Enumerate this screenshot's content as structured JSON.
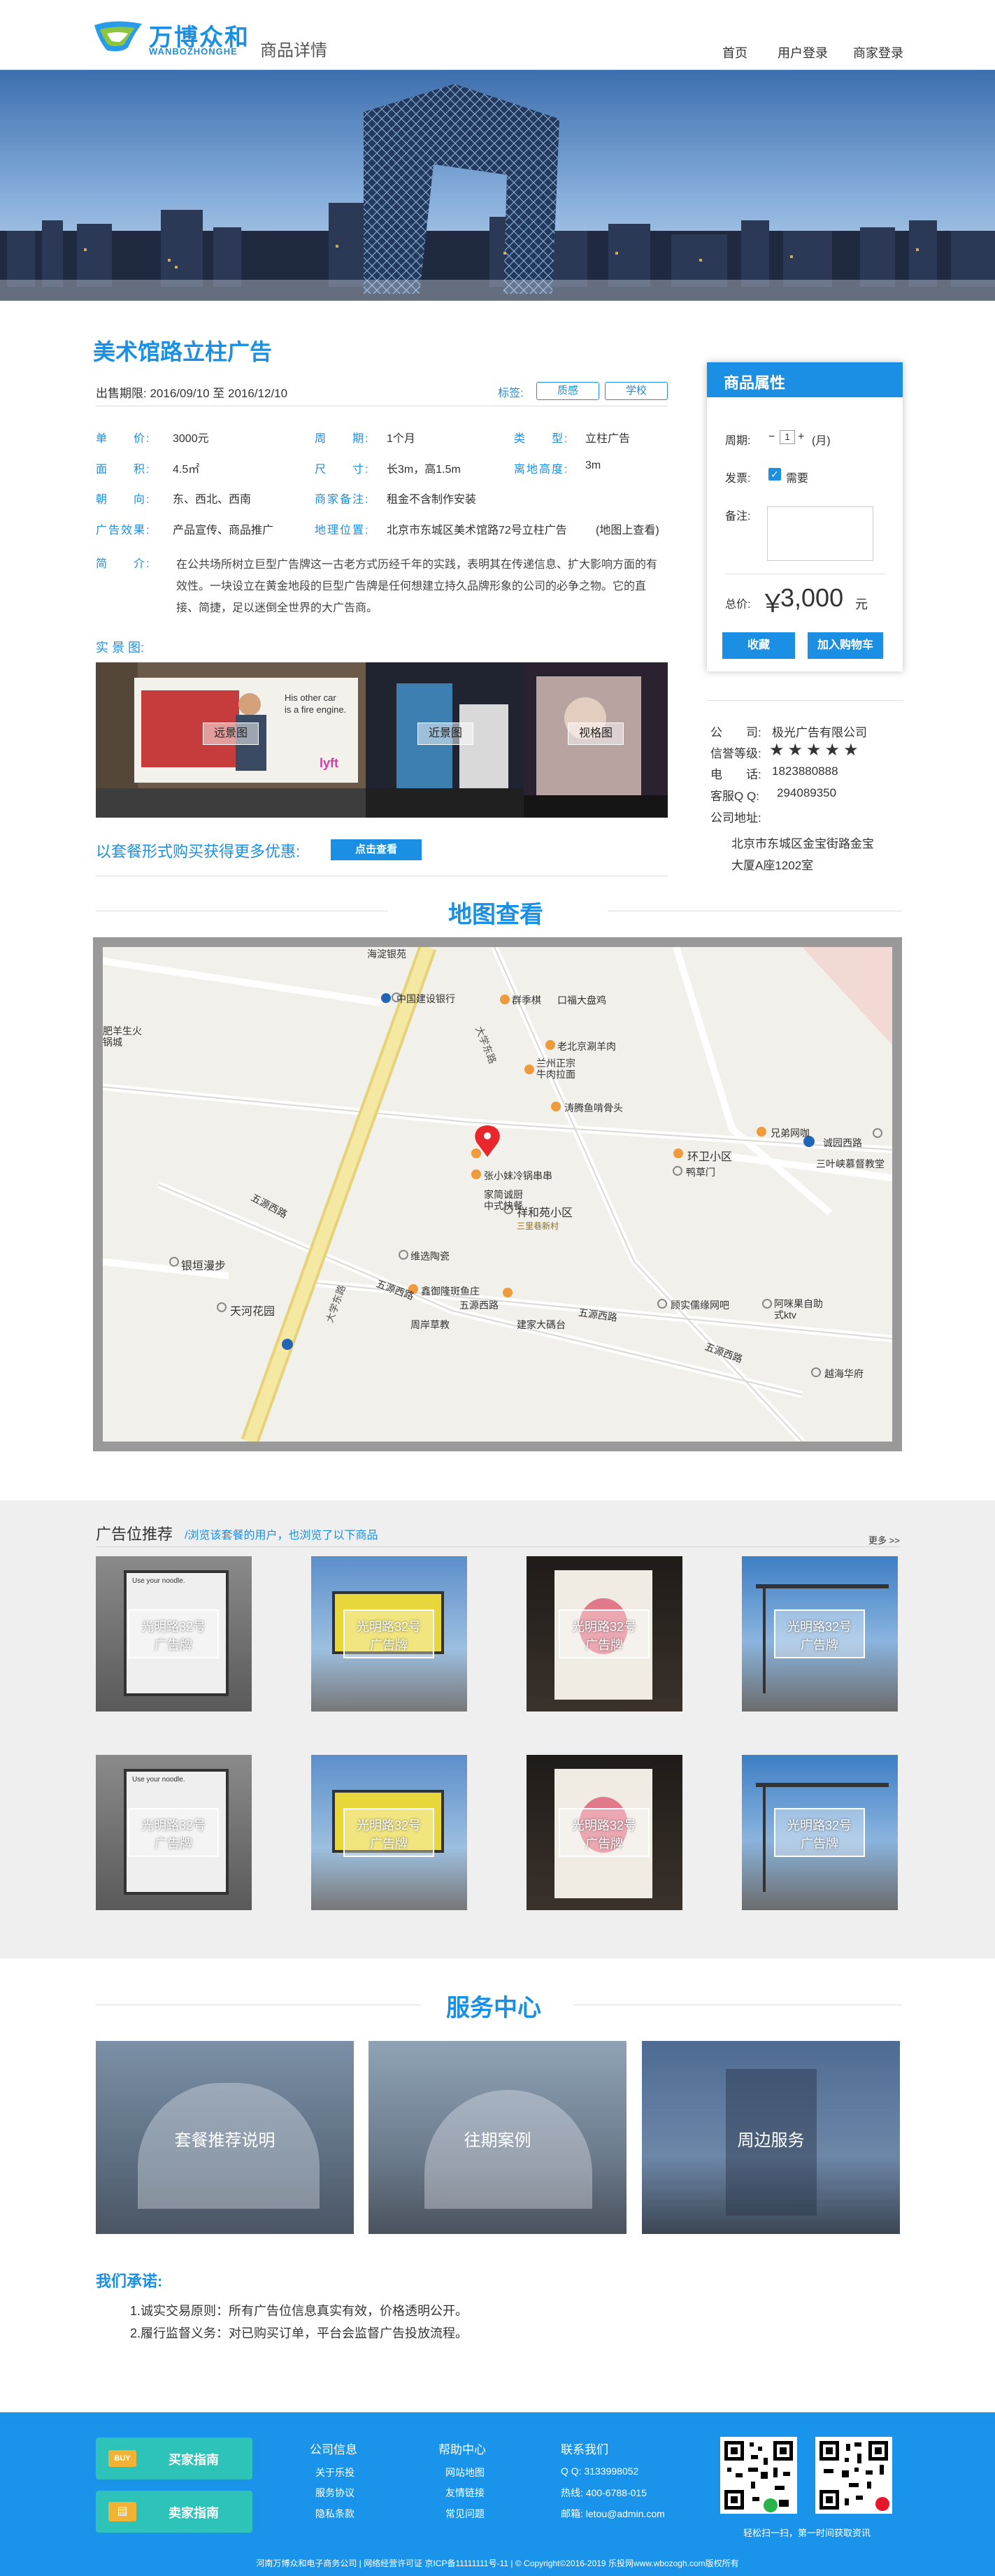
{
  "header": {
    "logo_cn": "万博众和",
    "logo_en": "WANBOZHONGHE",
    "page_title": "商品详情",
    "nav": [
      "首页",
      "用户登录",
      "商家登录"
    ]
  },
  "product": {
    "title": "美术馆路立柱广告",
    "period_label": "出售期限:",
    "period": "2016/09/10 至 2016/12/10",
    "tags_label": "标签:",
    "tags": [
      "质感",
      "学校"
    ],
    "fields": [
      {
        "label": "单　　价:",
        "value": "3000元"
      },
      {
        "label": "周　　期:",
        "value": "1个月"
      },
      {
        "label": "类　　型:",
        "value": "立柱广告"
      },
      {
        "label": "面　　积:",
        "value": "4.5㎡"
      },
      {
        "label": "尺　　寸:",
        "value": "长3m，高1.5m"
      },
      {
        "label": "离地高度:",
        "value": "3m"
      },
      {
        "label": "朝　　向:",
        "value": "东、西北、西南"
      },
      {
        "label": "商家备注:",
        "value": "租金不含制作安装"
      },
      {
        "label": "广告效果:",
        "value": "产品宣传、商品推广"
      },
      {
        "label": "地理位置:",
        "value": "北京市东城区美术馆路72号立柱广告"
      }
    ],
    "map_link": "(地图上查看)",
    "intro_label": "简　　介:",
    "intro": "在公共场所树立巨型广告牌这一古老方式历经千年的实践，表明其在传递信息、扩大影响方面的有效性。一块设立在黄金地段的巨型广告牌是任何想建立持久品牌形象的公司的必争之物。它的直接、简捷，足以迷倒全世界的大广告商。",
    "photos_label": "实 景 图:",
    "photos": [
      "远景图",
      "近景图",
      "视格图"
    ],
    "photo_ad_text": "His other car is a fire engine.",
    "promo": "以套餐形式购买获得更多优惠:",
    "promo_btn": "点击查看"
  },
  "side": {
    "title": "商品属性",
    "period_label": "周期:",
    "period_minus": "−",
    "period_value": "1",
    "period_plus": "+",
    "period_unit": "(月)",
    "invoice_label": "发票:",
    "invoice_option": "需要",
    "remark_label": "备注:",
    "total_label": "总价:",
    "total_currency": "￥",
    "total_value": "3,000",
    "total_unit": "元",
    "collect_btn": "收藏",
    "cart_btn": "加入购物车"
  },
  "company": {
    "name_label": "公　　司:",
    "name": "极光广告有限公司",
    "credit_label": "信誉等级:",
    "credit_stars": 5,
    "phone_label": "电　　话:",
    "phone": "1823880888",
    "qq_label": "客服Q Q:",
    "qq": "294089350",
    "address_label": "公司地址:",
    "address_line1": "北京市东城区金宝街路金宝",
    "address_line2": "大厦A座1202室"
  },
  "map": {
    "title": "地图查看",
    "labels": [
      "海淀银苑",
      "中国建设银行",
      "群季棋",
      "口福大盘鸡",
      "老北京涮羊肉",
      "兰州正宗牛肉拉面",
      "涛腾鱼啃骨头",
      "兄弟网咖",
      "诚园西路",
      "环卫小区",
      "鸭草门",
      "三叶峡慕督教堂",
      "张小妹冷锅串串",
      "家简诚厨中式快餐",
      "祥和苑小区",
      "三里巷新村",
      "维选陶瓷",
      "鑫御隆斑鱼庄",
      "五源西路",
      "五源西路",
      "五源西路",
      "银垣漫步",
      "周岸草教",
      "建家大碼台",
      "五源西路",
      "天河花园",
      "顾实儒缘网吧",
      "阿咪果自助式ktv",
      "越海华府",
      "五源西路",
      "肥羊生火锅城",
      "大学东路",
      "大学东路"
    ]
  },
  "recommend": {
    "title": "广告位推荐",
    "subtitle": "/浏览该套餐的用户，也浏览了以下商品",
    "more": "更多 >>",
    "card_line1": "光明路32号",
    "card_line2": "广告牌",
    "card_inner": "Use your noodle."
  },
  "service": {
    "title": "服务中心",
    "items": [
      "套餐推荐说明",
      "往期案例",
      "周边服务"
    ]
  },
  "promise": {
    "title": "我们承诺:",
    "items": [
      "1.诚实交易原则：所有广告位信息真实有效，价格透明公开。",
      "2.履行监督义务：对已购买订单，平台会监督广告投放流程。"
    ]
  },
  "footer": {
    "buy_guide": "买家指南",
    "sell_guide": "卖家指南",
    "info_title": "公司信息",
    "info_links": [
      "关于乐投",
      "服务协议",
      "隐私条款"
    ],
    "help_title": "帮助中心",
    "help_links": [
      "网站地图",
      "友情链接",
      "常见问题"
    ],
    "contact_title": "联系我们",
    "contact_lines": [
      "Q Q: 3133998052",
      "热线: 400-6788-015",
      "邮箱: letou@admin.com"
    ],
    "qr_caption": "轻松扫一扫，第一时间获取资讯",
    "bottom": "河南万博众和电子商务公司 | 网络经营许可证 京ICP备11111111号-11 | © Copyright©2016-2019  乐投网www.wbozogh.com版权所有"
  },
  "colors": {
    "accent": "#1a8fe3",
    "footer": "#1a94ea",
    "teal": "#2ec3b8"
  }
}
